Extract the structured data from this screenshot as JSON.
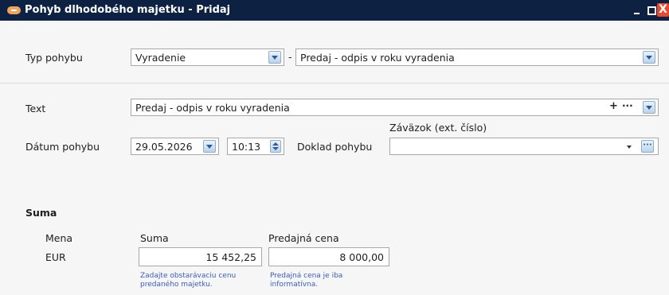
{
  "window": {
    "title": "Pohyb dlhodobého majetku - Pridaj",
    "close_glyph": "X"
  },
  "movement": {
    "type_label": "Typ pohybu",
    "type_value": "Vyradenie",
    "separator": "-",
    "subtype_value": "Predaj - odpis v roku vyradenia"
  },
  "text_row": {
    "label": "Text",
    "value": "Predaj - odpis v roku vyradenia",
    "plus_glyph": "+",
    "dots_glyph": "···"
  },
  "date_row": {
    "label": "Dátum pohybu",
    "date_value": "29.05.2026",
    "time_value": "10:13",
    "doc_label": "Doklad pohybu",
    "doc_caption": "Záväzok (ext. číslo)",
    "doc_value": "",
    "ell_glyph": "···"
  },
  "sum_section": {
    "title": "Suma",
    "currency_header": "Mena",
    "currency_value": "EUR",
    "amount_header": "Suma",
    "amount_value": "15 452,25",
    "amount_hint": "Zadajte obstarávaciu cenu predaného majetku.",
    "sale_header": "Predajná cena",
    "sale_value": "8 000,00",
    "sale_hint": "Predajná cena je iba informatívna."
  }
}
